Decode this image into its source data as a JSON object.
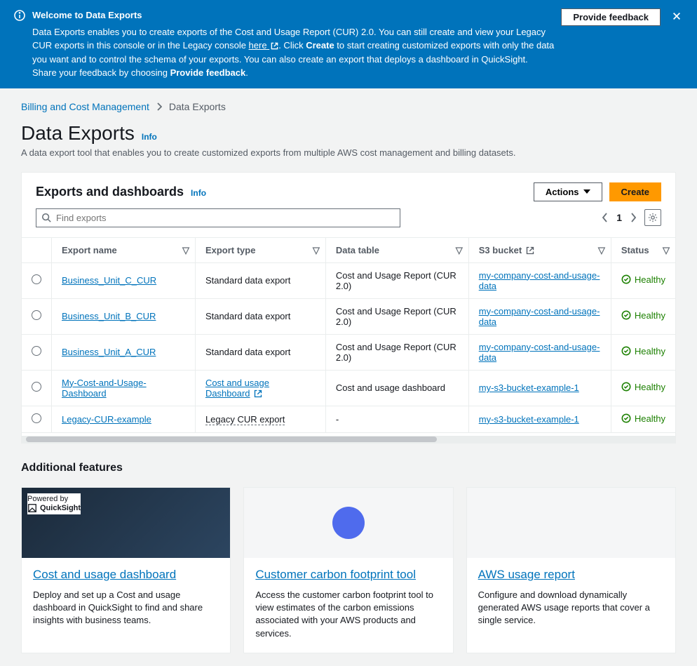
{
  "banner": {
    "title": "Welcome to Data Exports",
    "line1_a": "Data Exports enables you to create exports of the Cost and Usage Report (CUR) 2.0. You can still create and view your Legacy CUR exports in this console or in the Legacy console ",
    "here": "here",
    "line1_b": ". Click ",
    "create_word": "Create",
    "line1_c": " to start creating customized exports with only the data you want and to control the schema of your exports. You can also create an export that deploys a dashboard in QuickSight. Share your feedback by choosing ",
    "feedback_word": "Provide feedback",
    "line1_d": ".",
    "feedback_btn": "Provide feedback"
  },
  "breadcrumb": {
    "root": "Billing and Cost Management",
    "current": "Data Exports"
  },
  "heading": {
    "title": "Data Exports",
    "info": "Info",
    "desc": "A data export tool that enables you to create customized exports from multiple AWS cost management and billing datasets."
  },
  "panel": {
    "title": "Exports and dashboards",
    "info": "Info",
    "actions_btn": "Actions",
    "create_btn": "Create",
    "search_placeholder": "Find exports",
    "page": "1",
    "columns": {
      "name": "Export name",
      "type": "Export type",
      "table": "Data table",
      "bucket": "S3 bucket",
      "status": "Status"
    },
    "rows": [
      {
        "name": "Business_Unit_C_CUR",
        "type": "Standard data export",
        "type_style": "plain",
        "table": "Cost and Usage Report (CUR 2.0)",
        "bucket": "my-company-cost-and-usage-data",
        "status": "Healthy"
      },
      {
        "name": "Business_Unit_B_CUR",
        "type": "Standard data export",
        "type_style": "plain",
        "table": "Cost and Usage Report (CUR 2.0)",
        "bucket": "my-company-cost-and-usage-data",
        "status": "Healthy"
      },
      {
        "name": "Business_Unit_A_CUR",
        "type": "Standard data export",
        "type_style": "plain",
        "table": "Cost and Usage Report (CUR 2.0)",
        "bucket": "my-company-cost-and-usage-data",
        "status": "Healthy"
      },
      {
        "name": "My-Cost-and-Usage-Dashboard",
        "type": "Cost and usage Dashboard",
        "type_style": "link-ext",
        "table": "Cost and usage dashboard",
        "bucket": "my-s3-bucket-example-1",
        "status": "Healthy"
      },
      {
        "name": "Legacy-CUR-example",
        "type": "Legacy CUR export",
        "type_style": "dotted",
        "table": "-",
        "bucket": "my-s3-bucket-example-1",
        "status": "Healthy"
      }
    ]
  },
  "features": {
    "title": "Additional features",
    "cards": [
      {
        "title": "Cost and usage dashboard",
        "desc": "Deploy and set up a Cost and usage dashboard in QuickSight to find and share insights with business teams.",
        "img": "dark",
        "powered": "Powered by",
        "qs": "QuickSight"
      },
      {
        "title": "Customer carbon footprint tool",
        "desc": "Access the customer carbon footprint tool to view estimates of the carbon emissions associated with your AWS products and services.",
        "img": "dash"
      },
      {
        "title": "AWS usage report",
        "desc": "Configure and download dynamically generated AWS usage reports that cover a single service.",
        "img": "light"
      }
    ]
  }
}
